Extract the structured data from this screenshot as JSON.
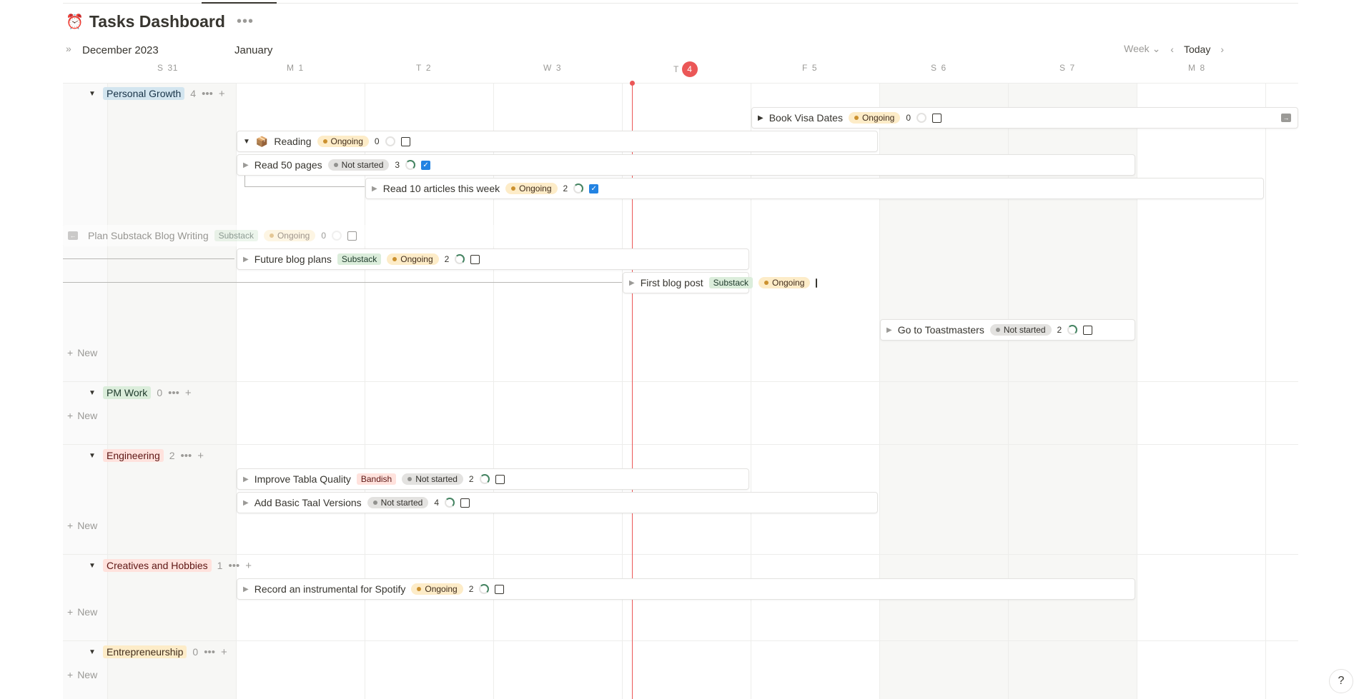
{
  "title": {
    "emoji": "⏰",
    "text": "Tasks Dashboard"
  },
  "header": {
    "months": [
      "December 2023",
      "January"
    ],
    "view": "Week",
    "today": "Today",
    "days": [
      {
        "name": "S",
        "num": "31"
      },
      {
        "name": "M",
        "num": "1"
      },
      {
        "name": "T",
        "num": "2"
      },
      {
        "name": "W",
        "num": "3"
      },
      {
        "name": "T",
        "num": "4"
      },
      {
        "name": "F",
        "num": "5"
      },
      {
        "name": "S",
        "num": "6"
      },
      {
        "name": "S",
        "num": "7"
      },
      {
        "name": "M",
        "num": "8"
      }
    ]
  },
  "groups": [
    {
      "label": "Personal Growth",
      "count": "4",
      "color": "#d3e5ef"
    },
    {
      "label": "PM Work",
      "count": "0",
      "color": "#dbeddb"
    },
    {
      "label": "Engineering",
      "count": "2",
      "color": "#ffe2dd"
    },
    {
      "label": "Creatives and Hobbies",
      "count": "1",
      "color": "#ffe2dd"
    },
    {
      "label": "Entrepreneurship",
      "count": "0",
      "color": "#fdecc8"
    }
  ],
  "new_label": "New",
  "tasks": [
    {
      "title": "Book Visa Dates",
      "status": "Ongoing",
      "count": "0"
    },
    {
      "title": "Reading",
      "emoji": "📦",
      "status": "Ongoing",
      "count": "0"
    },
    {
      "title": "Read 50 pages",
      "status": "Not started",
      "count": "3"
    },
    {
      "title": "Read 10 articles this week",
      "status": "Ongoing",
      "count": "2"
    },
    {
      "title": "Plan Substack Blog Writing",
      "tag": "Substack",
      "status": "Ongoing",
      "count": "0"
    },
    {
      "title": "Future blog plans",
      "tag": "Substack",
      "status": "Ongoing",
      "count": "2"
    },
    {
      "title": "First blog post",
      "tag": "Substack",
      "status": "Ongoing"
    },
    {
      "title": "Go to Toastmasters",
      "status": "Not started",
      "count": "2"
    },
    {
      "title": "Improve Tabla Quality",
      "tag": "Bandish",
      "status": "Not started",
      "count": "2"
    },
    {
      "title": "Add Basic Taal Versions",
      "status": "Not started",
      "count": "4"
    },
    {
      "title": "Record an instrumental for Spotify",
      "status": "Ongoing",
      "count": "2"
    }
  ],
  "help": "?"
}
